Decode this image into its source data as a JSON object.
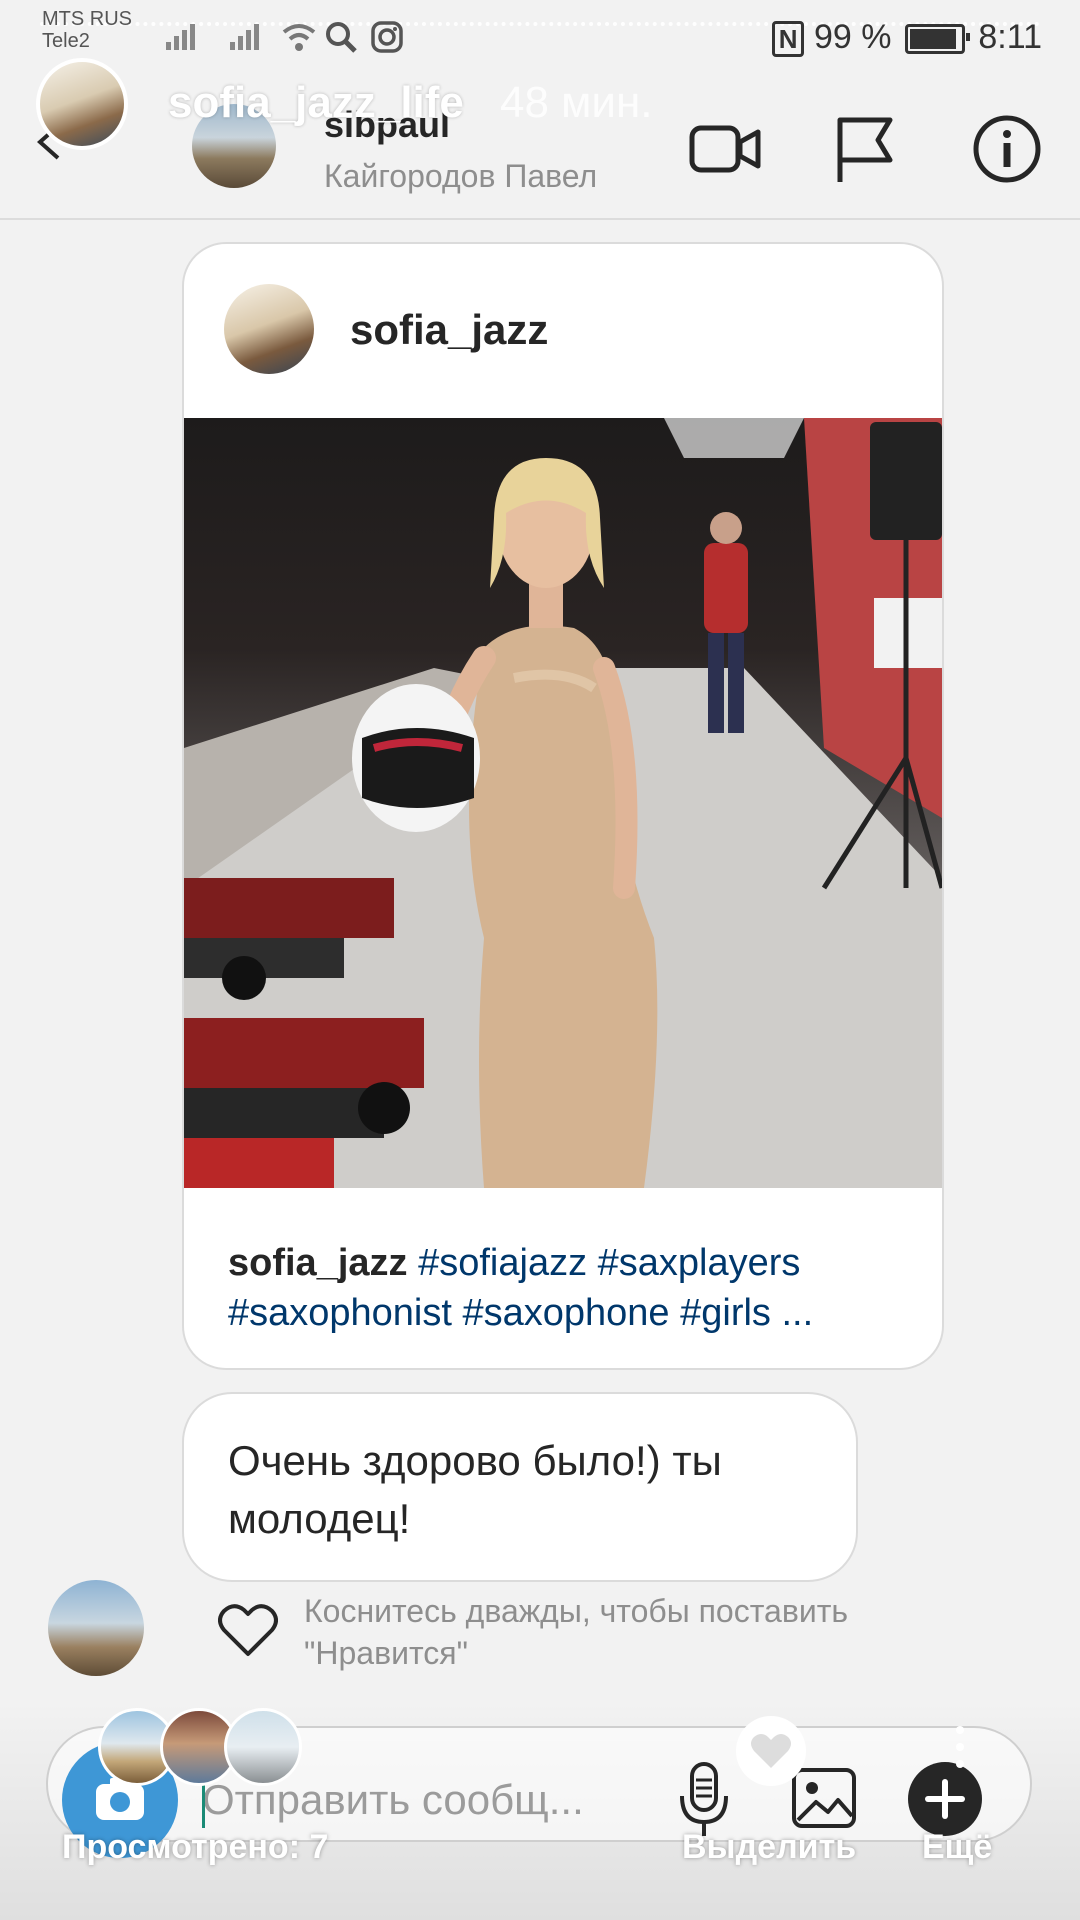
{
  "status_bar": {
    "carrier_1": "MTS RUS",
    "carrier_2": "Tele2",
    "nfc": "N",
    "battery": "99 %",
    "time": "8:11"
  },
  "story": {
    "username": "sofia_jazz_life",
    "time_ago": "48 мин."
  },
  "chat_header": {
    "username": "sibpaul",
    "full_name": "Кайгородов Павел"
  },
  "shared_post": {
    "username": "sofia_jazz",
    "caption_user": "sofia_jazz",
    "caption_tags": "#sofiajazz #saxplayers #saxophonist #saxophone #girls ..."
  },
  "message": {
    "text": "Очень здорово было!) ты молодец!"
  },
  "like_hint": "Коснитесь дважды, чтобы поставить \"Нравится\"",
  "composer": {
    "placeholder": "Отправить сообщ..."
  },
  "story_footer": {
    "seen": "Просмотрено: 7",
    "highlight": "Выделить",
    "more": "Ещё"
  },
  "colors": {
    "hashtag": "#00376b",
    "camera_button": "#3e97d6",
    "muted_text": "#8e8e8e"
  }
}
